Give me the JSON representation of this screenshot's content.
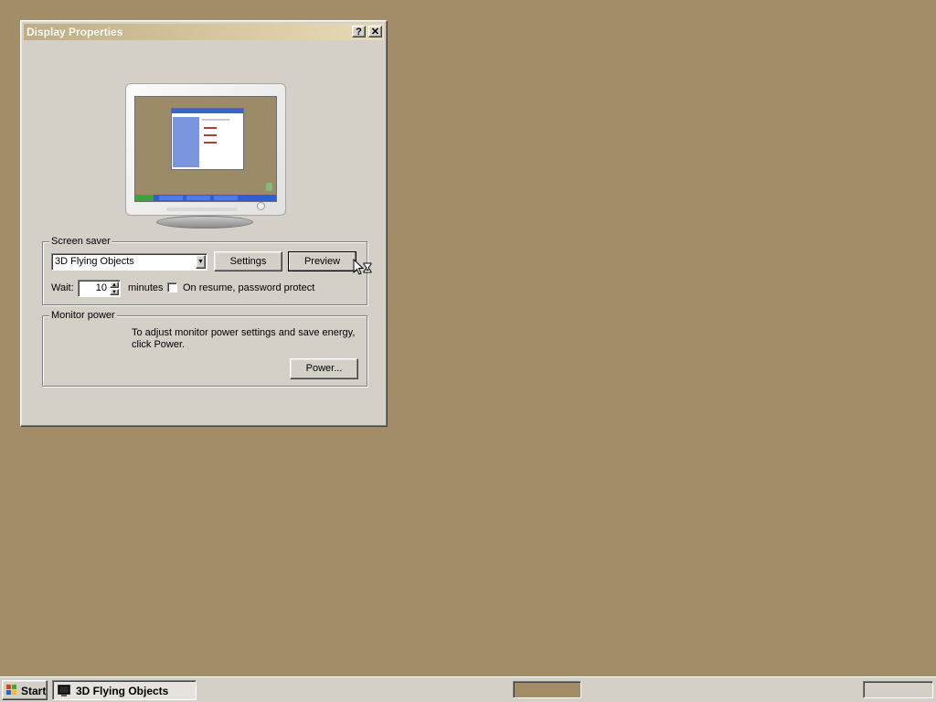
{
  "window": {
    "title": "Display Properties",
    "help_button": "?",
    "close_button": "✕"
  },
  "screen_saver": {
    "group_label": "Screen saver",
    "selected": "3D Flying Objects",
    "settings_label": "Settings",
    "preview_label": "Preview",
    "wait_label": "Wait:",
    "wait_value": "10",
    "minutes_label": "minutes",
    "password_label": "On resume, password protect",
    "password_checked": false
  },
  "monitor_power": {
    "group_label": "Monitor power",
    "description_line1": "To adjust monitor power settings and save energy,",
    "description_line2": "click Power.",
    "power_label": "Power..."
  },
  "taskbar": {
    "start_label": "Start",
    "task_label": "3D Flying Objects"
  },
  "colors": {
    "desktop": "#a38d68",
    "face": "#d4d0c8",
    "title_gradient_start": "#bfae84",
    "title_gradient_end": "#e9dbb6"
  }
}
